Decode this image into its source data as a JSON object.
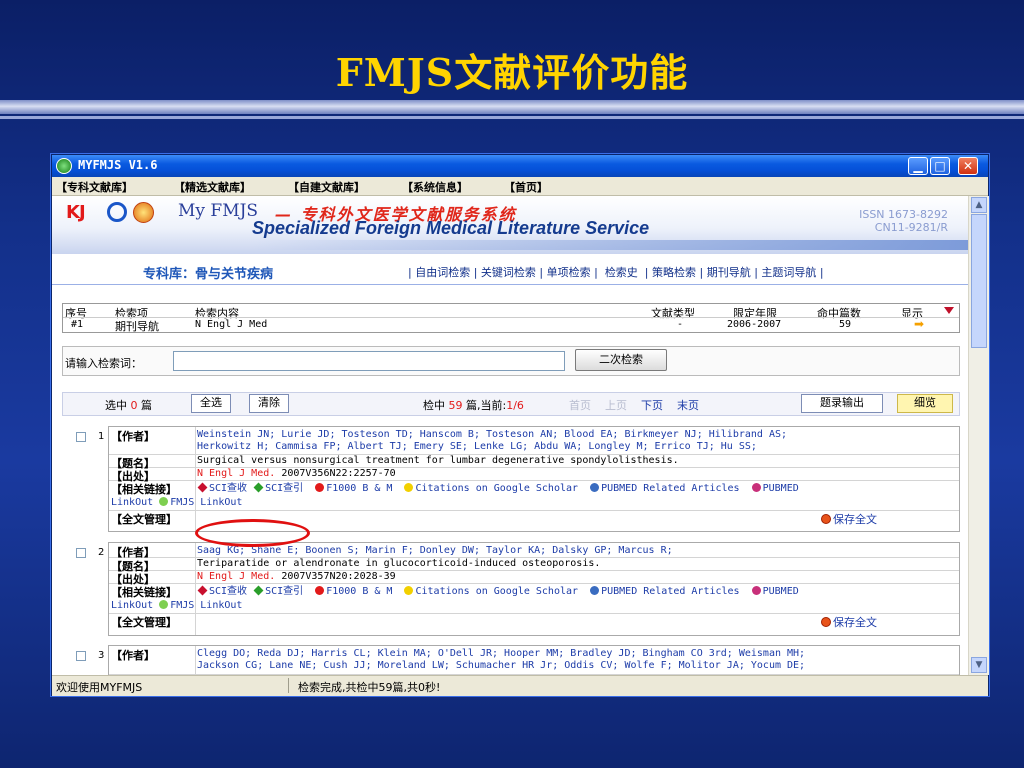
{
  "slide": {
    "title": "FMJS文献评价功能"
  },
  "window": {
    "title": "MYFMJS V1.6",
    "menu": [
      "【专科文献库】",
      "【精选文献库】",
      "【自建文献库】",
      "【系统信息】",
      "【首页】"
    ]
  },
  "banner": {
    "kj": "KJ",
    "my_fmjs": "My FMJS",
    "cn_title": "— 专科外文医学文献服务系统",
    "en_title": "Specialized Foreign Medical Literature Service",
    "issn": "ISSN 1673-8292",
    "cn_num": "CN11-9281/R"
  },
  "subnav": {
    "library": "专科库：骨与关节疾病",
    "links": [
      "自由词检索",
      "关键词检索",
      "单项检索",
      "检索史",
      "策略检索",
      "期刊导航",
      "主题词导航"
    ]
  },
  "query_table": {
    "headers": [
      "序号",
      "检索项",
      "检索内容",
      "文献类型",
      "限定年限",
      "命中篇数",
      "显示"
    ],
    "row": [
      "#1",
      "期刊导航",
      "N Engl J Med",
      "-",
      "2006-2007",
      "59"
    ]
  },
  "search": {
    "label": "请输入检索词：",
    "value": "",
    "button": "二次检索"
  },
  "toolbar": {
    "selected_prefix": "选中",
    "selected_count": "0",
    "selected_suffix": "篇",
    "select_all": "全选",
    "clear": "清除",
    "hits_prefix": "检中",
    "hits_count": "59",
    "hits_mid": "篇,当前:",
    "page": "1/6",
    "first_page": "首页",
    "prev_page": "上页",
    "next_page": "下页",
    "last_page": "末页",
    "export": "题录输出",
    "detail": "细览"
  },
  "labels": {
    "author": "【作者】",
    "title": "【题名】",
    "source": "【出处】",
    "links": "【相关链接】",
    "fulltext": "【全文管理】",
    "save_full": "保存全文"
  },
  "links": {
    "sci_cite": "SCI查收",
    "sci_ref": "SCI查引",
    "f1000": "F1000 B & M",
    "scholar": "Citations on Google Scholar",
    "pubmed_related": "PUBMED Related Articles",
    "pubmed_linkout": "PUBMED",
    "linkout": "LinkOut",
    "fmjs_linkout": "FMJS LinkOut"
  },
  "records": [
    {
      "num": "1",
      "authors1": "Weinstein JN; Lurie JD; Tosteson TD; Hanscom B; Tosteson AN; Blood EA; Birkmeyer NJ; Hilibrand AS;",
      "authors2": "Herkowitz H; Cammisa FP; Albert TJ; Emery SE; Lenke LG; Abdu WA; Longley M; Errico TJ; Hu SS;",
      "title": "Surgical versus nonsurgical treatment for lumbar degenerative spondylolisthesis.",
      "source_journal": "N Engl J Med.",
      "source_detail": "2007V356N22:2257-70"
    },
    {
      "num": "2",
      "authors1": "Saag KG; Shane E; Boonen S; Marin F; Donley DW; Taylor KA; Dalsky GP; Marcus R;",
      "title": "Teriparatide or alendronate in glucocorticoid-induced osteoporosis.",
      "source_journal": "N Engl J Med.",
      "source_detail": "2007V357N20:2028-39"
    },
    {
      "num": "3",
      "authors1": "Clegg DO; Reda DJ; Harris CL; Klein MA; O'Dell JR; Hooper MM; Bradley JD; Bingham CO 3rd; Weisman MH;",
      "authors2": "Jackson CG; Lane NE; Cush JJ; Moreland LW; Schumacher HR Jr; Oddis CV; Wolfe F; Molitor JA; Yocum DE;"
    }
  ],
  "statusbar": {
    "left": "欢迎使用MYFMJS",
    "right": "检索完成,共检中59篇,共0秒!"
  },
  "colors": {
    "slide_title": "#ffd400",
    "highlight_ellipse": "#e01010",
    "hits_red": "#e21a1a"
  }
}
